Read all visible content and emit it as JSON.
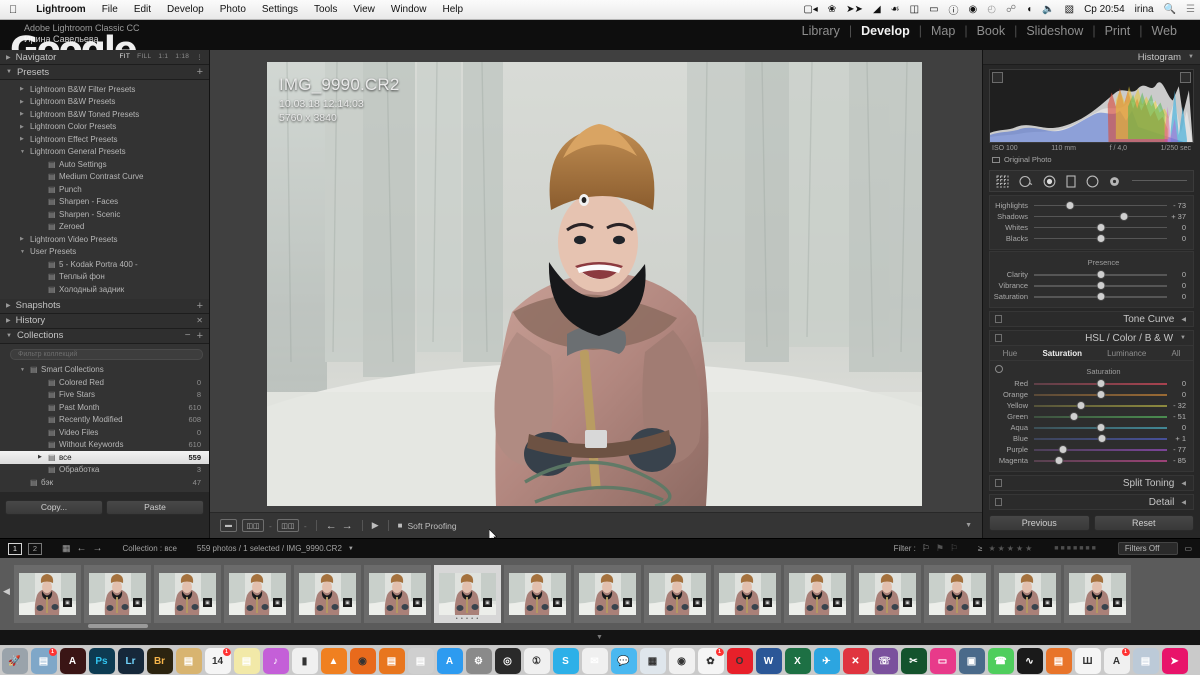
{
  "menubar": {
    "apple_icon": "apple-logo-icon",
    "items": [
      "Lightroom",
      "File",
      "Edit",
      "Develop",
      "Photo",
      "Settings",
      "Tools",
      "View",
      "Window",
      "Help"
    ],
    "status_icons": [
      "screen-record-icon",
      "dropbox-icon",
      "transfer-icon",
      "flag-icon",
      "tree-icon",
      "clipboard-icon",
      "display-icon",
      "info-icon",
      "eye-icon",
      "clock-icon",
      "bluetooth-icon",
      "wifi-icon",
      "volume-icon",
      "flag-us-icon"
    ],
    "clock": "Ср 20:54",
    "user": "irina",
    "search_icon": "search-icon",
    "notifications_icon": "notification-center-icon"
  },
  "titlebar": {
    "app_line1": "Adobe Lightroom Classic CC",
    "app_line2": "Ирина Савельева",
    "watermark": "Google",
    "modules": [
      "Library",
      "Develop",
      "Map",
      "Book",
      "Slideshow",
      "Print",
      "Web"
    ],
    "active_module": "Develop"
  },
  "left_panel": {
    "navigator": {
      "title": "Navigator",
      "zoom_options": [
        "FIT",
        "FILL",
        "1:1",
        "1:18"
      ],
      "active_zoom": "FIT"
    },
    "presets": {
      "title": "Presets",
      "add_icon": "plus-icon",
      "items": [
        {
          "label": "Lightroom B&W Filter Presets",
          "level": 1,
          "expanded": false
        },
        {
          "label": "Lightroom B&W Presets",
          "level": 1,
          "expanded": false
        },
        {
          "label": "Lightroom B&W Toned Presets",
          "level": 1,
          "expanded": false
        },
        {
          "label": "Lightroom Color Presets",
          "level": 1,
          "expanded": false
        },
        {
          "label": "Lightroom Effect Presets",
          "level": 1,
          "expanded": false
        },
        {
          "label": "Lightroom General Presets",
          "level": 1,
          "expanded": true
        },
        {
          "label": "Auto Settings",
          "level": 2
        },
        {
          "label": "Medium Contrast Curve",
          "level": 2
        },
        {
          "label": "Punch",
          "level": 2
        },
        {
          "label": "Sharpen - Faces",
          "level": 2
        },
        {
          "label": "Sharpen - Scenic",
          "level": 2
        },
        {
          "label": "Zeroed",
          "level": 2
        },
        {
          "label": "Lightroom Video Presets",
          "level": 1,
          "expanded": false
        },
        {
          "label": "User Presets",
          "level": 1,
          "expanded": true
        },
        {
          "label": "5 - Kodak Portra 400 -",
          "level": 2
        },
        {
          "label": "Теплый фон",
          "level": 2
        },
        {
          "label": "Холодный задник",
          "level": 2
        }
      ]
    },
    "snapshots": {
      "title": "Snapshots",
      "add_icon": "plus-icon"
    },
    "history": {
      "title": "History",
      "clear_icon": "close-icon"
    },
    "collections": {
      "title": "Collections",
      "minus_icon": "minus-icon",
      "plus_icon": "plus-icon",
      "search_placeholder": "Фильтр коллекций",
      "items": [
        {
          "label": "Smart Collections",
          "level": 1,
          "count": "",
          "expanded": true,
          "selected": false
        },
        {
          "label": "Colored Red",
          "level": 2,
          "count": "0",
          "selected": false
        },
        {
          "label": "Five Stars",
          "level": 2,
          "count": "8",
          "selected": false
        },
        {
          "label": "Past Month",
          "level": 2,
          "count": "610",
          "selected": false
        },
        {
          "label": "Recently Modified",
          "level": 2,
          "count": "608",
          "selected": false
        },
        {
          "label": "Video Files",
          "level": 2,
          "count": "0",
          "selected": false
        },
        {
          "label": "Without Keywords",
          "level": 2,
          "count": "610",
          "selected": false
        },
        {
          "label": "все",
          "level": 2,
          "count": "559",
          "selected": true
        },
        {
          "label": "Обработка",
          "level": 2,
          "count": "3",
          "selected": false
        },
        {
          "label": "бэк",
          "level": 1,
          "count": "47",
          "selected": false
        }
      ]
    },
    "copy_button": "Copy...",
    "paste_button": "Paste"
  },
  "image": {
    "filename": "IMG_9990.CR2",
    "capture_date": "10.03.18 12:14:03",
    "dimensions": "5760 x 3840"
  },
  "center_toolbar": {
    "view_icon": "loupe-view-icon",
    "before_after_icon": "before-after-icon",
    "compare_icon": "compare-split-icon",
    "prev_icon": "arrow-left-icon",
    "next_icon": "arrow-right-icon",
    "play_icon": "play-icon",
    "soft_proofing_label": "Soft Proofing",
    "soft_proofing_checked": false,
    "caret_icon": "chevron-up-icon"
  },
  "right_panel": {
    "histogram": {
      "title": "Histogram",
      "collapse_icon": "chevron-down-icon",
      "shadow_clip_icon": "shadow-clipping-icon",
      "highlight_clip_icon": "highlight-clipping-icon",
      "exif": [
        "ISO 100",
        "110 mm",
        "f / 4,0",
        "1/250 sec"
      ],
      "original_photo_label": "Original Photo"
    },
    "tools": [
      "crop-overlay-icon",
      "spot-removal-icon",
      "red-eye-icon",
      "graduated-filter-icon",
      "radial-filter-icon",
      "adjustment-brush-icon"
    ],
    "basic_sliders": [
      {
        "label": "Highlights",
        "value": "- 73",
        "pos": 27
      },
      {
        "label": "Shadows",
        "value": "+ 37",
        "pos": 68
      },
      {
        "label": "Whites",
        "value": "0",
        "pos": 50
      },
      {
        "label": "Blacks",
        "value": "0",
        "pos": 50
      }
    ],
    "presence": {
      "title": "Presence",
      "sliders": [
        {
          "label": "Clarity",
          "value": "0",
          "pos": 50
        },
        {
          "label": "Vibrance",
          "value": "0",
          "pos": 50
        },
        {
          "label": "Saturation",
          "value": "0",
          "pos": 50
        }
      ]
    },
    "tone_curve": {
      "title": "Tone Curve",
      "expand_icon": "chevron-left-icon"
    },
    "hsl": {
      "title": "HSL / Color / B & W",
      "expand_icon": "chevron-down-icon",
      "tabs": [
        "Hue",
        "Saturation",
        "Luminance",
        "All"
      ],
      "active_tab": "Saturation",
      "sub_title": "Saturation",
      "target_icon": "target-adjust-icon",
      "sliders": [
        {
          "label": "Red",
          "value": "0",
          "pos": 50,
          "c1": "#5e4048",
          "c2": "#a8424f"
        },
        {
          "label": "Orange",
          "value": "0",
          "pos": 50,
          "c1": "#5a4a38",
          "c2": "#9a6a34"
        },
        {
          "label": "Yellow",
          "value": "- 32",
          "pos": 35,
          "c1": "#55533a",
          "c2": "#8d8a3e"
        },
        {
          "label": "Green",
          "value": "- 51",
          "pos": 30,
          "c1": "#3e5140",
          "c2": "#4a8d50"
        },
        {
          "label": "Aqua",
          "value": "0",
          "pos": 50,
          "c1": "#3c4f56",
          "c2": "#418795"
        },
        {
          "label": "Blue",
          "value": "+ 1",
          "pos": 51,
          "c1": "#3d4458",
          "c2": "#465099"
        },
        {
          "label": "Purple",
          "value": "- 77",
          "pos": 22,
          "c1": "#4c4057",
          "c2": "#7a4498"
        },
        {
          "label": "Magenta",
          "value": "- 85",
          "pos": 19,
          "c1": "#56414e",
          "c2": "#9c4277"
        }
      ]
    },
    "split_toning": {
      "title": "Split Toning",
      "expand_icon": "chevron-left-icon"
    },
    "detail": {
      "title": "Detail",
      "expand_icon": "chevron-left-icon"
    },
    "previous_button": "Previous",
    "reset_button": "Reset"
  },
  "filmstrip_bar": {
    "page1": "1",
    "page2": "2",
    "grid_icon": "grid-view-icon",
    "back_icon": "arrow-left-icon",
    "forward_icon": "arrow-right-icon",
    "source": "Collection : все",
    "status": "559 photos / 1 selected / IMG_9990.CR2",
    "dropdown_icon": "chevron-down-icon",
    "filter_label": "Filter :",
    "flag_icons": [
      "flag-pick-icon",
      "flag-unflagged-icon",
      "flag-reject-icon"
    ],
    "rating_prefix": "≥",
    "stars": "★★★★★",
    "color_labels": [
      "red",
      "yellow",
      "green",
      "blue",
      "purple",
      "none",
      "custom"
    ],
    "filters_select": "Filters Off",
    "lock_icon": "lock-icon"
  },
  "filmstrip": {
    "left_arrow_icon": "chevron-left-icon",
    "selected_index": 6,
    "selected_stars": "• • • • •",
    "thumb_badge": "badge-icon",
    "count": 16
  },
  "dock": {
    "apps": [
      {
        "name": "finder-icon",
        "bg": "#2f8fd8",
        "glyph": "☺"
      },
      {
        "name": "safari-icon",
        "bg": "#2d9bf0",
        "glyph": "◎"
      },
      {
        "name": "launchpad-icon",
        "bg": "#9aa3ab",
        "glyph": "🚀"
      },
      {
        "name": "preview-icon",
        "bg": "#7fa7c8",
        "glyph": "▤",
        "badge": "1"
      },
      {
        "name": "acrobat-reader-icon",
        "bg": "#3a1515",
        "glyph": "A"
      },
      {
        "name": "photoshop-icon",
        "bg": "#0d3b52",
        "glyph": "Ps"
      },
      {
        "name": "lightroom-icon",
        "bg": "#16283a",
        "glyph": "Lr"
      },
      {
        "name": "bridge-icon",
        "bg": "#2c2410",
        "glyph": "Br"
      },
      {
        "name": "notes-icon",
        "bg": "#d8b470",
        "glyph": "▤"
      },
      {
        "name": "calendar-icon",
        "bg": "#f5f5f5",
        "glyph": "14",
        "badge": "1"
      },
      {
        "name": "stickies-icon",
        "bg": "#f2e9a8",
        "glyph": "▤"
      },
      {
        "name": "itunes-icon",
        "bg": "#c45fd8",
        "glyph": "♪"
      },
      {
        "name": "numbers-icon",
        "bg": "#f0f0f0",
        "glyph": "▮"
      },
      {
        "name": "vlc-icon",
        "bg": "#f08020",
        "glyph": "▲"
      },
      {
        "name": "firefox-icon",
        "bg": "#e86a1c",
        "glyph": "◉"
      },
      {
        "name": "ibooks-icon",
        "bg": "#e8761e",
        "glyph": "▤"
      },
      {
        "name": "faststone-icon",
        "bg": "#cfcfcf",
        "glyph": "▤"
      },
      {
        "name": "app-store-icon",
        "bg": "#2d9bf0",
        "glyph": "A"
      },
      {
        "name": "system-preferences-icon",
        "bg": "#8a8a8a",
        "glyph": "⚙"
      },
      {
        "name": "camera-icon",
        "bg": "#2a2a2a",
        "glyph": "◎"
      },
      {
        "name": "1password-icon",
        "bg": "#f0f0f0",
        "glyph": "①"
      },
      {
        "name": "skype-icon",
        "bg": "#2db0e8",
        "glyph": "S"
      },
      {
        "name": "mail-icon",
        "bg": "#f0f0f0",
        "glyph": "✉"
      },
      {
        "name": "messages-icon",
        "bg": "#4ab8f0",
        "glyph": "💬"
      },
      {
        "name": "keynote-icon",
        "bg": "#dfe6ec",
        "glyph": "▦"
      },
      {
        "name": "chrome-icon",
        "bg": "#f0f0f0",
        "glyph": "◉"
      },
      {
        "name": "photos-icon",
        "bg": "#f5f5f5",
        "glyph": "✿",
        "badge": "1"
      },
      {
        "name": "opera-icon",
        "bg": "#e8202a",
        "glyph": "O"
      },
      {
        "name": "word-icon",
        "bg": "#2b5797",
        "glyph": "W"
      },
      {
        "name": "excel-icon",
        "bg": "#1d7044",
        "glyph": "X"
      },
      {
        "name": "telegram-icon",
        "bg": "#2ca5e0",
        "glyph": "✈"
      },
      {
        "name": "xmind-icon",
        "bg": "#e0343f",
        "glyph": "✕"
      },
      {
        "name": "viber-icon",
        "bg": "#7b519d",
        "glyph": "☏"
      },
      {
        "name": "scissors-icon",
        "bg": "#14532d",
        "glyph": "✂"
      },
      {
        "name": "display-icon",
        "bg": "#e83a8a",
        "glyph": "▭"
      },
      {
        "name": "screenshot-icon",
        "bg": "#4a6a8a",
        "glyph": "▣"
      },
      {
        "name": "whatsapp-icon",
        "bg": "#4fce5d",
        "glyph": "☎"
      },
      {
        "name": "audacity-icon",
        "bg": "#1a1a1a",
        "glyph": "∿"
      },
      {
        "name": "window-icon",
        "bg": "#e8742a",
        "glyph": "▤"
      },
      {
        "name": "wiki-icon",
        "bg": "#f5f5f5",
        "glyph": "Ш"
      },
      {
        "name": "acrobat-pro-icon",
        "bg": "#f0f0f0",
        "glyph": "A",
        "badge": "1"
      },
      {
        "name": "utilities-icon",
        "bg": "#bccad8",
        "glyph": "▤"
      },
      {
        "name": "transfer-icon",
        "bg": "#e8136a",
        "glyph": "➤"
      }
    ],
    "folder": {
      "name": "downloads-folder-icon"
    },
    "trash": {
      "name": "trash-icon"
    }
  }
}
